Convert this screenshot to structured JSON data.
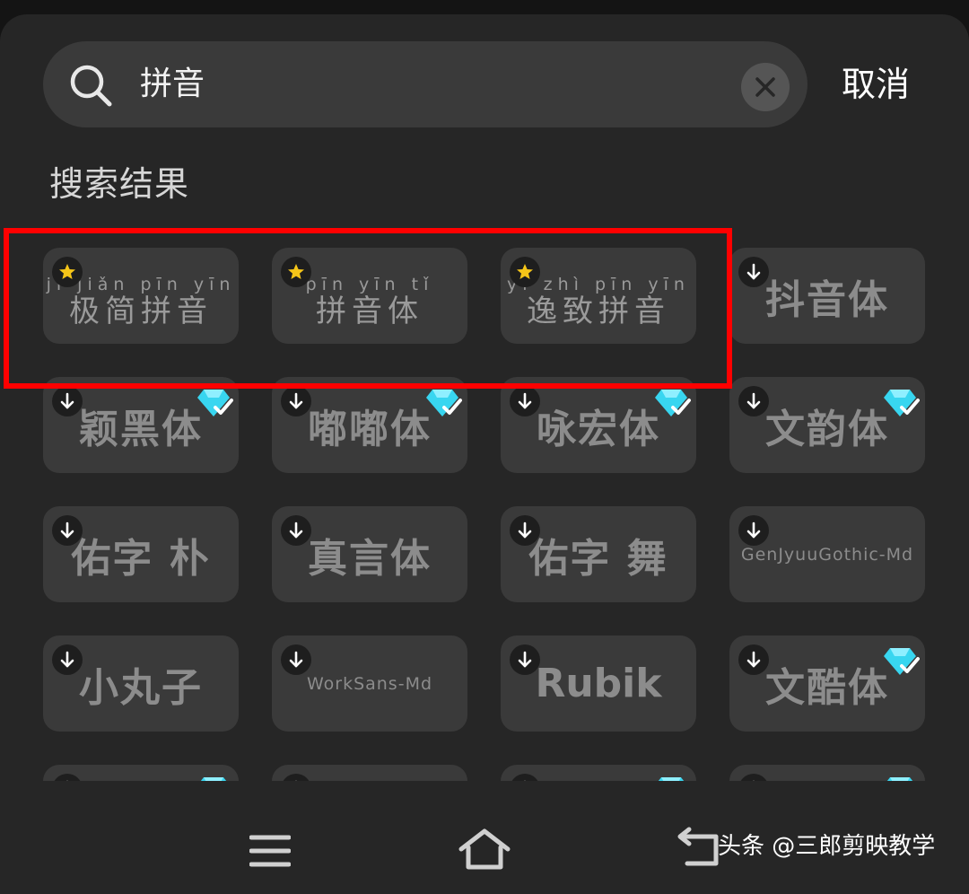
{
  "search": {
    "query": "拼音",
    "cancel_label": "取消"
  },
  "section_title": "搜索结果",
  "fonts": [
    {
      "label": "极简拼音",
      "pinyin": "jí jiǎn pīn yīn",
      "badge": "star",
      "vip": false
    },
    {
      "label": "拼音体",
      "pinyin": "pīn yīn tǐ",
      "badge": "star",
      "vip": false
    },
    {
      "label": "逸致拼音",
      "pinyin": "yì zhì pīn yīn",
      "badge": "star",
      "vip": false
    },
    {
      "label": "抖音体",
      "badge": "download",
      "vip": false
    },
    {
      "label": "颖黑体",
      "badge": "download",
      "vip": true
    },
    {
      "label": "嘟嘟体",
      "badge": "download",
      "vip": true
    },
    {
      "label": "咏宏体",
      "badge": "download",
      "vip": true
    },
    {
      "label": "文韵体",
      "badge": "download",
      "vip": true
    },
    {
      "label": "佑字 朴",
      "badge": "download",
      "vip": false
    },
    {
      "label": "真言体",
      "badge": "download",
      "vip": false
    },
    {
      "label": "佑字 舞",
      "badge": "download",
      "vip": false
    },
    {
      "label": "GenJyuuGothic-Md",
      "badge": "download",
      "vip": false
    },
    {
      "label": "小丸子",
      "badge": "download",
      "vip": false
    },
    {
      "label": "WorkSans-Md",
      "badge": "download",
      "vip": false
    },
    {
      "label": "Rubik",
      "badge": "download",
      "vip": false
    },
    {
      "label": "文酷体",
      "badge": "download",
      "vip": true
    },
    {
      "label": "",
      "badge": "download",
      "vip": true
    },
    {
      "label": "",
      "badge": "download",
      "vip": false
    },
    {
      "label": "",
      "badge": "download",
      "vip": true
    },
    {
      "label": "",
      "badge": "download",
      "vip": true
    }
  ],
  "nav": {
    "icons": [
      "menu-icon",
      "home-icon",
      "back-icon"
    ]
  },
  "watermark": "头条 @三郎剪映教学",
  "colors": {
    "highlight": "#ff0000",
    "star": "#f5c518",
    "vip": "#38d6f0"
  }
}
